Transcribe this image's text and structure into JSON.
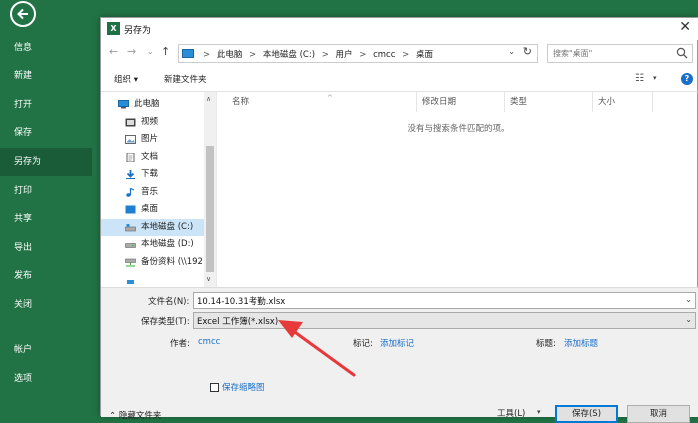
{
  "backstage": {
    "back_glyph": "←",
    "items": [
      {
        "label": "信息"
      },
      {
        "label": "新建"
      },
      {
        "label": "打开"
      },
      {
        "label": "保存"
      },
      {
        "label": "另存为"
      },
      {
        "label": "打印"
      },
      {
        "label": "共享"
      },
      {
        "label": "导出"
      },
      {
        "label": "发布"
      },
      {
        "label": "关闭"
      },
      {
        "label": "帐户"
      },
      {
        "label": "选项"
      }
    ],
    "active_index": 4,
    "bg_color": "#217346"
  },
  "dialog": {
    "app_icon_letter": "X",
    "title": "另存为",
    "close_glyph": "✕",
    "nav": {
      "back": "←",
      "forward": "→",
      "up_dropdown": "⌄",
      "up": "↑"
    },
    "address": {
      "crumbs": [
        "此电脑",
        "本地磁盘 (C:)",
        "用户",
        "cmcc",
        "桌面"
      ],
      "separator": ">",
      "dropdown": "⌄",
      "refresh": "↻"
    },
    "search": {
      "placeholder": "搜索\"桌面\""
    },
    "toolbar": {
      "organize": "组织 ▾",
      "new_folder": "新建文件夹",
      "view_glyph": "☷",
      "view_dd": "▾",
      "help": "?"
    },
    "tree": [
      {
        "label": "此电脑",
        "icon": "pc-icon"
      },
      {
        "label": "视频",
        "icon": "video-icon"
      },
      {
        "label": "图片",
        "icon": "pictures-icon"
      },
      {
        "label": "文档",
        "icon": "documents-icon"
      },
      {
        "label": "下载",
        "icon": "download-icon"
      },
      {
        "label": "音乐",
        "icon": "music-icon"
      },
      {
        "label": "桌面",
        "icon": "desktop-icon"
      },
      {
        "label": "本地磁盘 (C:)",
        "icon": "drive-c-icon"
      },
      {
        "label": "本地磁盘 (D:)",
        "icon": "drive-d-icon"
      },
      {
        "label": "备份资料 (\\\\192",
        "icon": "network-drive-icon"
      }
    ],
    "tree_selected_index": 7,
    "scroll": {
      "up": "∧",
      "down": "∨"
    },
    "columns": [
      "名称",
      "修改日期",
      "类型",
      "大小"
    ],
    "sort_glyph": "^",
    "empty_message": "没有与搜索条件匹配的项。",
    "form": {
      "filename_label": "文件名(N):",
      "filename_value": "10.14-10.31考勤.xlsx",
      "type_label": "保存类型(T):",
      "type_value": "Excel 工作簿(*.xlsx)",
      "author_label": "作者:",
      "author_value": "cmcc",
      "tags_label": "标记:",
      "tags_value": "添加标记",
      "title_label": "标题:",
      "title_value": "添加标题",
      "thumbnail_label": "保存缩略图",
      "hide_folders": "⌃ 隐藏文件夹",
      "tools": "工具(L)",
      "tools_dd": "▾",
      "save": "保存(S)",
      "cancel": "取消",
      "dropdown": "⌄"
    }
  },
  "colors": {
    "accent": "#0078d7",
    "link": "#1a6fc9",
    "annotation": "#e8393a",
    "selection": "#cce4f7"
  }
}
